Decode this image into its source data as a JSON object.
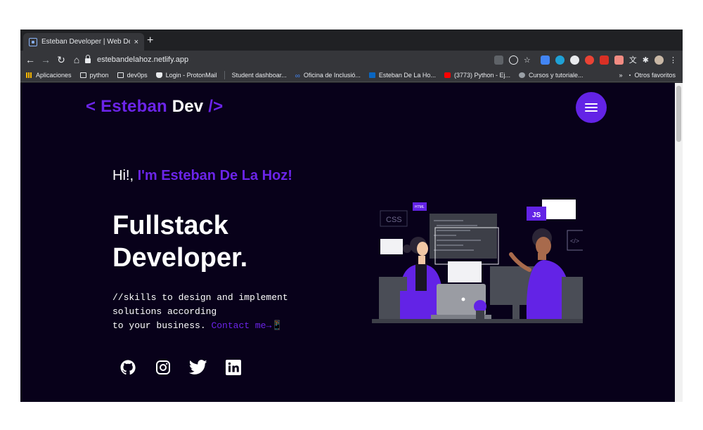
{
  "browser": {
    "tab": {
      "title": "Esteban Developer | Web Deve",
      "close": "×"
    },
    "new_tab": "+",
    "url": "estebandelahoz.netlify.app",
    "nav": {
      "back": "←",
      "forward": "→",
      "reload": "↻",
      "home": "⌂"
    },
    "bookmarks": [
      {
        "label": "Aplicaciones",
        "icon": "apps-grid-icon"
      },
      {
        "label": "python",
        "icon": "folder-icon"
      },
      {
        "label": "dev0ps",
        "icon": "folder-icon"
      },
      {
        "label": "Login - ProtonMail",
        "icon": "protonmail-icon"
      },
      {
        "label": "Student dashboar...",
        "icon": "none"
      },
      {
        "label": "Oficina de Inclusió...",
        "icon": "link-icon"
      },
      {
        "label": "Esteban De La Ho...",
        "icon": "linkedin-icon"
      },
      {
        "label": "(3773) Python - Ej...",
        "icon": "youtube-icon"
      },
      {
        "label": "Cursos y tutoriale...",
        "icon": "cursos-icon"
      }
    ],
    "bookmarks_more": "»",
    "other_favorites": "Otros favoritos"
  },
  "site": {
    "logo": {
      "open": "< Esteban",
      "dev": " Dev",
      "close": " />"
    },
    "greeting": {
      "prefix": "Hi!, ",
      "name": "I'm Esteban De La Hoz!"
    },
    "headline": {
      "line1": "Fullstack",
      "line2": "Developer."
    },
    "skills": {
      "line1": "//skills to design and implement",
      "line2": "solutions according",
      "line3": "to your business. ",
      "contact": "Contact me→📱"
    },
    "socials": [
      "github-icon",
      "instagram-icon",
      "twitter-icon",
      "linkedin-icon"
    ],
    "illustration": {
      "css_label": "CSS",
      "js_label": "JS",
      "html_label": "HTML",
      "code_label": "</>"
    }
  },
  "colors": {
    "accent": "#6b24e8",
    "page_bg": "#08011a",
    "text": "#ffffff"
  }
}
